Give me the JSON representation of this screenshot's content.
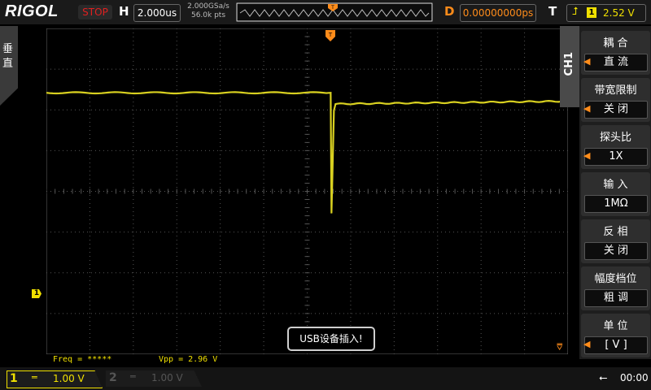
{
  "brand": "RIGOL",
  "topbar": {
    "run_status": "STOP",
    "h_label": "H",
    "timebase": "2.000us",
    "sample_rate": "2.000GSa/s",
    "mem_depth": "56.0k pts",
    "d_label": "D",
    "delay": "0.00000000ps",
    "t_label": "T",
    "trigger_channel": "1",
    "trigger_level": "2.52 V"
  },
  "left_tab": {
    "label": "垂直"
  },
  "channel_marker": "1",
  "toast": "USB设备插入!",
  "measurements": {
    "freq": "Freq = *****",
    "vpp": "Vpp = 2.96 V"
  },
  "menu": {
    "tab_label": "CH1",
    "items": [
      {
        "title": "耦  合",
        "value": "直  流",
        "has_arrow": true
      },
      {
        "title": "带宽限制",
        "value": "关  闭",
        "has_arrow": true
      },
      {
        "title": "探头比",
        "value": "1X",
        "has_arrow": true
      },
      {
        "title": "输  入",
        "value": "1MΩ",
        "has_arrow": false
      },
      {
        "title": "反  相",
        "value": "关  闭",
        "has_arrow": false
      },
      {
        "title": "幅度档位",
        "value": "粗  调",
        "has_arrow": false
      },
      {
        "title": "单  位",
        "value": "[  V  ]",
        "has_arrow": true
      }
    ]
  },
  "bottombar": {
    "ch1_num": "1",
    "ch1_coupling": "═",
    "ch1_scale": "1.00 V",
    "ch2_num": "2",
    "ch2_coupling": "═",
    "ch2_scale": "1.00 V",
    "time": "00:00"
  },
  "colors": {
    "ch1": "#f0e000",
    "accent": "#ff8c1a",
    "stop": "#e02020"
  },
  "waveform": {
    "trace_color": "#d8d020",
    "pre_level_fraction": 0.1975,
    "dip_fraction": 0.5675,
    "post_level_fraction": 0.232
  }
}
